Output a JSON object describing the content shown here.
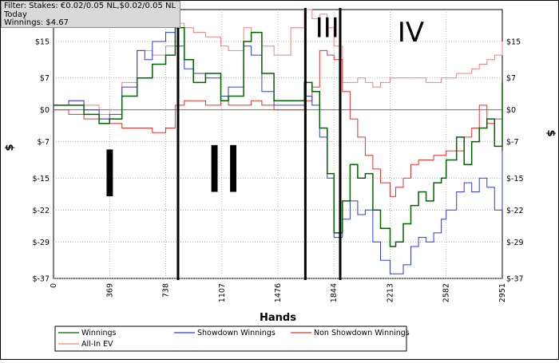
{
  "filter": {
    "stakes": "Filter: Stakes: €0.02/0.05 NL,$0.02/0.05 NL",
    "period": "Today",
    "winnings": "Winnings: $4.67"
  },
  "chart_data": {
    "type": "line",
    "xlabel": "Hands",
    "ylabel": "$",
    "x_ticks": [
      0,
      369,
      738,
      1107,
      1476,
      1844,
      2213,
      2582,
      2951
    ],
    "y_ticks": [
      15,
      7,
      0,
      -7,
      -15,
      -22,
      -29,
      -37
    ],
    "y_tick_labels": [
      "$15",
      "$7",
      "$0",
      "$-7",
      "$-15",
      "$-22",
      "$-29",
      "$-37"
    ],
    "xlim": [
      0,
      2951
    ],
    "ylim": [
      -37,
      22
    ],
    "grid": true,
    "legend_position": "bottom",
    "annotations": [
      {
        "text": "I",
        "x": 370,
        "y": -19
      },
      {
        "text": "II",
        "x": 1120,
        "y": -18
      },
      {
        "text": "III",
        "x": 1800,
        "y": 16
      },
      {
        "text": "IV",
        "x": 2350,
        "y": 15
      }
    ],
    "separators_x": [
      819,
      1656,
      1885
    ],
    "series": [
      {
        "name": "Winnings",
        "color": "#006400",
        "x": [
          0,
          100,
          200,
          300,
          369,
          450,
          550,
          650,
          738,
          800,
          860,
          920,
          1000,
          1100,
          1150,
          1250,
          1300,
          1370,
          1450,
          1560,
          1650,
          1700,
          1750,
          1800,
          1844,
          1900,
          1950,
          2000,
          2050,
          2100,
          2150,
          2213,
          2250,
          2300,
          2350,
          2400,
          2450,
          2500,
          2550,
          2582,
          2650,
          2700,
          2750,
          2800,
          2850,
          2900,
          2951
        ],
        "y": [
          1,
          1,
          -1,
          -3,
          -2,
          3,
          7,
          10,
          12,
          18,
          11,
          6,
          8,
          2,
          3,
          15,
          17,
          8,
          2,
          2,
          6,
          4,
          -4,
          -14,
          -27,
          -20,
          -12,
          -15,
          -14,
          -22,
          -26,
          -30,
          -29,
          -25,
          -21,
          -18,
          -20,
          -16,
          -15,
          -11,
          -6,
          -12,
          -7,
          -4,
          -2,
          -8,
          6
        ]
      },
      {
        "name": "Showdown Winnings",
        "color": "#2e3ae6",
        "x": [
          0,
          100,
          200,
          300,
          369,
          450,
          550,
          600,
          650,
          738,
          800,
          860,
          920,
          1000,
          1100,
          1150,
          1250,
          1300,
          1370,
          1450,
          1560,
          1650,
          1700,
          1750,
          1800,
          1844,
          1900,
          1950,
          2000,
          2050,
          2100,
          2150,
          2213,
          2250,
          2300,
          2350,
          2400,
          2450,
          2500,
          2550,
          2582,
          2650,
          2700,
          2750,
          2800,
          2850,
          2900,
          2951
        ],
        "y": [
          1,
          2,
          0,
          -2,
          -1,
          5,
          13,
          11,
          15,
          17,
          14,
          9,
          8,
          7,
          3,
          5,
          14,
          12,
          4,
          1,
          1,
          3,
          1,
          -6,
          -15,
          -28,
          -24,
          -20,
          -23,
          -22,
          -29,
          -33,
          -36,
          -36,
          -34,
          -30,
          -28,
          -29,
          -27,
          -24,
          -22,
          -18,
          -16,
          -18,
          -15,
          -17,
          -22,
          -9
        ]
      },
      {
        "name": "Non Showdown Winnings",
        "color": "#e8312c",
        "x": [
          0,
          100,
          200,
          300,
          369,
          450,
          550,
          650,
          738,
          800,
          860,
          920,
          1000,
          1100,
          1150,
          1250,
          1300,
          1370,
          1450,
          1560,
          1650,
          1700,
          1750,
          1800,
          1844,
          1900,
          1950,
          2000,
          2050,
          2100,
          2150,
          2213,
          2250,
          2300,
          2350,
          2400,
          2450,
          2500,
          2550,
          2582,
          2650,
          2700,
          2750,
          2800,
          2850,
          2900,
          2951
        ],
        "y": [
          0,
          -1,
          -2,
          -2,
          -3,
          -4,
          -4,
          -5,
          -4,
          1,
          2,
          2,
          1,
          2,
          1,
          1,
          2,
          1,
          0,
          0,
          2,
          5,
          13,
          12,
          11,
          4,
          -2,
          -6,
          -10,
          -13,
          -16,
          -19,
          -17,
          -15,
          -12,
          -11,
          -11,
          -10,
          -10,
          -9,
          -9,
          -6,
          -4,
          1,
          -3,
          -2,
          -1
        ]
      },
      {
        "name": "All-In EV",
        "color": "#f28080",
        "x": [
          0,
          100,
          200,
          300,
          369,
          450,
          550,
          650,
          738,
          800,
          860,
          920,
          1000,
          1100,
          1150,
          1250,
          1300,
          1370,
          1450,
          1560,
          1650,
          1700,
          1750,
          1800,
          1844,
          1900,
          1950,
          2000,
          2050,
          2100,
          2150,
          2213,
          2250,
          2300,
          2350,
          2400,
          2450,
          2500,
          2550,
          2582,
          2650,
          2700,
          2750,
          2800,
          2850,
          2900,
          2951
        ],
        "y": [
          1,
          2,
          1,
          -1,
          0,
          6,
          13,
          12,
          14,
          19,
          18,
          17,
          16,
          14,
          13,
          18,
          17,
          14,
          12,
          18,
          22,
          20,
          21,
          18,
          14,
          6,
          6,
          7,
          6,
          5,
          6,
          7,
          7,
          7,
          7,
          7,
          6,
          6,
          7,
          7,
          8,
          8,
          9,
          10,
          11,
          12,
          15
        ]
      }
    ]
  },
  "legend": {
    "items": [
      "Winnings",
      "Showdown Winnings",
      "Non Showdown Winnings",
      "All-In EV"
    ]
  }
}
